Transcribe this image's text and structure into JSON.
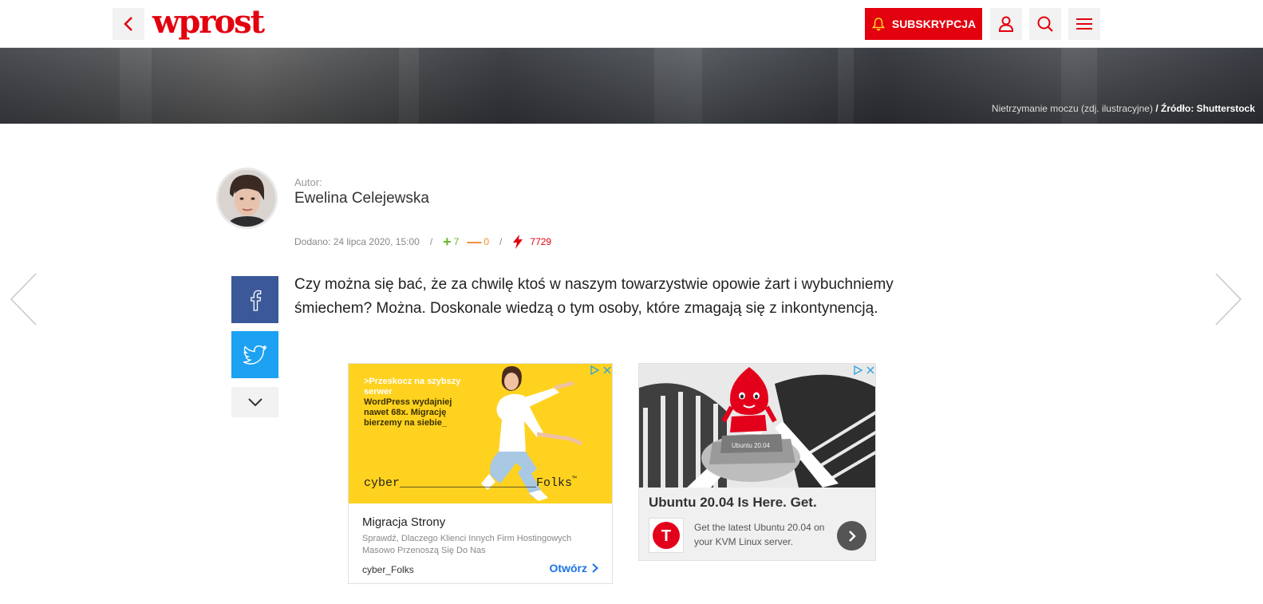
{
  "header": {
    "logo_text": "wprost",
    "subscribe_label": "SUBSKRYPCJA",
    "icons": [
      "back-arrow-icon",
      "bell-icon",
      "user-icon",
      "search-icon",
      "menu-icon"
    ],
    "brand_color": "#e3000f"
  },
  "hero": {
    "caption": "Nietrzymanie moczu (zdj. ilustracyjne)",
    "source": "/ Źródło: Shutterstock"
  },
  "author": {
    "label": "Autor:",
    "name": "Ewelina Celejewska"
  },
  "meta": {
    "date": "Dodano: 24 lipca 2020,",
    "time": "15:00",
    "sep": "/",
    "plus_sign": "+",
    "plus_votes": "7",
    "minus_sign": "—",
    "minus_votes": "0",
    "views": "7729"
  },
  "share": {
    "icons": [
      "facebook-icon",
      "twitter-icon",
      "chevron-down-icon"
    ]
  },
  "lead": "Czy można się bać, że za chwilę ktoś w naszym towarzystwie opowie żart i wybuchniemy śmiechem? Można. Doskonale wiedzą o tym osoby, które zmagają się z inkontynencją.",
  "ad1": {
    "promo_hl": ">Przeskocz na szybszy serwer",
    "promo": "WordPress wydajniej nawet 68x. Migrację bierzemy na siebie_",
    "brand": "cyber___________________Folks",
    "brand_tm": "™",
    "title": "Migracja Strony",
    "desc": "Sprawdź, Dlaczego Klienci Innych Firm Hostingowych Masowo Przenoszą Się Do Nas",
    "advertiser": "cyber_Folks",
    "cta": "Otwórz"
  },
  "ad2": {
    "title": "Ubuntu 20.04 Is Here. Get.",
    "logo_letter": "T",
    "desc": "Get the latest Ubuntu 20.04 on your KVM Linux server.",
    "box_label": "Ubuntu 20.04"
  }
}
